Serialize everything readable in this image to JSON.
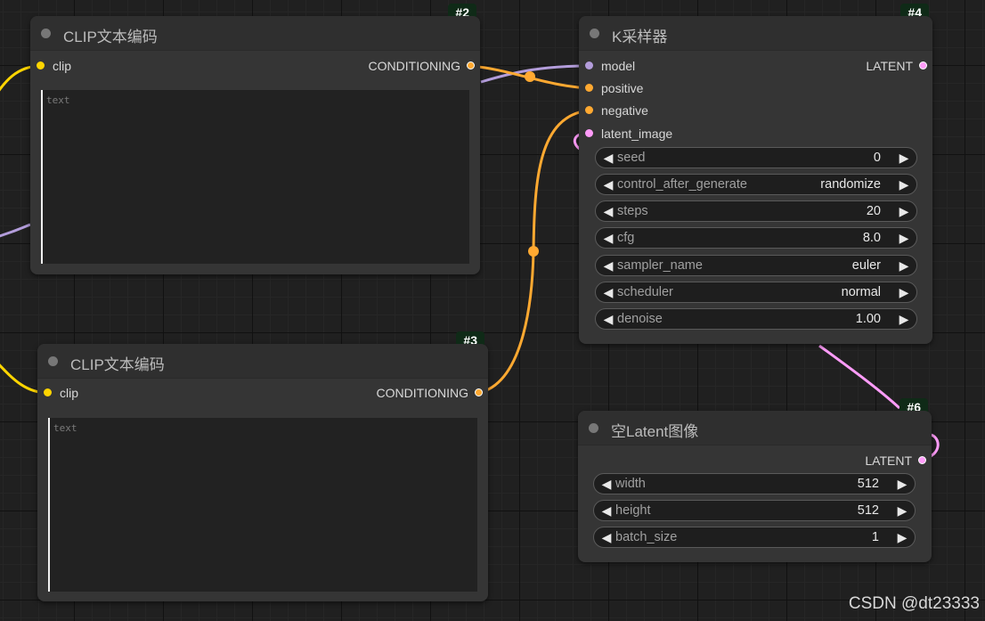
{
  "colors": {
    "clip": "#ffd500",
    "conditioning": "#ffa931",
    "model": "#b39ddb",
    "latent": "#ff9cf9"
  },
  "nodes": {
    "clip_top": {
      "badge": "#2",
      "title": "CLIP文本编码",
      "input_clip": "clip",
      "output": "CONDITIONING",
      "text_placeholder": "text"
    },
    "clip_bottom": {
      "badge": "#3",
      "title": "CLIP文本编码",
      "input_clip": "clip",
      "output": "CONDITIONING",
      "text_placeholder": "text"
    },
    "ksampler": {
      "badge": "#4",
      "title": "K采样器",
      "inputs": [
        "model",
        "positive",
        "negative",
        "latent_image"
      ],
      "output": "LATENT",
      "widgets": [
        {
          "label": "seed",
          "value": "0"
        },
        {
          "label": "control_after_generate",
          "value": "randomize"
        },
        {
          "label": "steps",
          "value": "20"
        },
        {
          "label": "cfg",
          "value": "8.0"
        },
        {
          "label": "sampler_name",
          "value": "euler"
        },
        {
          "label": "scheduler",
          "value": "normal"
        },
        {
          "label": "denoise",
          "value": "1.00"
        }
      ]
    },
    "empty_latent": {
      "badge": "#6",
      "title": "空Latent图像",
      "output": "LATENT",
      "widgets": [
        {
          "label": "width",
          "value": "512"
        },
        {
          "label": "height",
          "value": "512"
        },
        {
          "label": "batch_size",
          "value": "1"
        }
      ]
    }
  },
  "arrows": {
    "left": "◀",
    "right": "▶"
  },
  "watermark": "CSDN @dt23333"
}
